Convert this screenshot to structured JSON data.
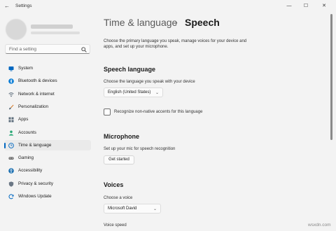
{
  "window": {
    "title": "Settings",
    "minimize": "—",
    "maximize": "☐",
    "close": "✕"
  },
  "search": {
    "placeholder": "Find a setting"
  },
  "nav": [
    {
      "label": "System",
      "icon": "monitor-icon",
      "color": "#0067c0"
    },
    {
      "label": "Bluetooth & devices",
      "icon": "bluetooth-icon",
      "color": "#0078d4"
    },
    {
      "label": "Network & internet",
      "icon": "wifi-icon",
      "color": "#5b6b7a"
    },
    {
      "label": "Personalization",
      "icon": "brush-icon",
      "color": "#d67b2a"
    },
    {
      "label": "Apps",
      "icon": "apps-icon",
      "color": "#5b6b7a"
    },
    {
      "label": "Accounts",
      "icon": "person-icon",
      "color": "#2aa876"
    },
    {
      "label": "Time & language",
      "icon": "globe-clock-icon",
      "color": "#0067c0",
      "active": true
    },
    {
      "label": "Gaming",
      "icon": "gamepad-icon",
      "color": "#6b6b6b"
    },
    {
      "label": "Accessibility",
      "icon": "accessibility-icon",
      "color": "#1b6fb0"
    },
    {
      "label": "Privacy & security",
      "icon": "shield-icon",
      "color": "#6b7785"
    },
    {
      "label": "Windows Update",
      "icon": "update-icon",
      "color": "#0067c0"
    }
  ],
  "breadcrumb": {
    "parent": "Time & language",
    "separator": "›",
    "current": "Speech"
  },
  "intro": "Choose the primary language you speak, manage voices for your device and apps, and set up your microphone.",
  "speech_language": {
    "heading": "Speech language",
    "prompt": "Choose the language you speak with your device",
    "selected": "English (United States)",
    "checkbox_label": "Recognize non-native accents for this language",
    "checkbox_checked": false
  },
  "microphone": {
    "heading": "Microphone",
    "prompt": "Set up your mic for speech recognition",
    "button": "Get started"
  },
  "voices": {
    "heading": "Voices",
    "prompt": "Choose a voice",
    "selected": "Microsoft David",
    "speed_label": "Voice speed"
  },
  "watermark": "wsxdn.com"
}
